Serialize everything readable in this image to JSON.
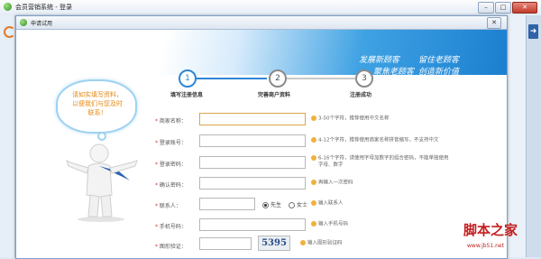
{
  "outer_window": {
    "title": "会员营销系统 - 登录"
  },
  "dialog": {
    "title": "申请试用",
    "close_label": "✕"
  },
  "banner": {
    "slogans": [
      "发展新顾客",
      "留住老顾客",
      "聚焦老顾客",
      "创造新价值"
    ]
  },
  "steps": [
    {
      "number": "1",
      "label": "填写注册信息"
    },
    {
      "number": "2",
      "label": "完善商户资料"
    },
    {
      "number": "3",
      "label": "注册成功"
    }
  ],
  "bubble": {
    "text": "请如实填写资料，以便我们与您及时联系！"
  },
  "form": {
    "merchant_name": {
      "label": "商家名称：",
      "tip": "3-50个字符，推荐使用中文名称"
    },
    "login_account": {
      "label": "登录账号：",
      "tip": "4-12个字符，推荐使用商家名称拼音缩写，不支持中文"
    },
    "login_password": {
      "label": "登录密码：",
      "tip1": "6-16个字符，请使用字母加数字的组合密码，不能单独使用",
      "tip2": "字母、数字"
    },
    "confirm_password": {
      "label": "确认密码：",
      "tip": "再输入一次密码"
    },
    "contact": {
      "label": "联系人：",
      "gender_male": "先生",
      "gender_female": "女士",
      "tip": "输入联系人"
    },
    "phone": {
      "label": "手机号码：",
      "tip": "输入手机号码"
    },
    "captcha": {
      "label": "图形验证：",
      "code": "5395",
      "tip": "输入图形验证码"
    }
  },
  "watermark": {
    "main": "脚本之家",
    "sub": "www.jb51.net"
  },
  "colors": {
    "accent": "#2c86d6",
    "tip_icon": "#f0b13b",
    "required": "#dd3333"
  },
  "icons": {
    "outer_app": "app-logo-icon",
    "side": "arrow-icon"
  }
}
